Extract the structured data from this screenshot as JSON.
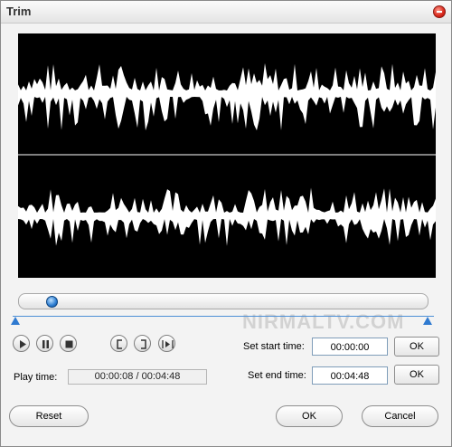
{
  "window": {
    "title": "Trim"
  },
  "waveform": {
    "background": "#000000",
    "color": "#ffffff",
    "channels": 2
  },
  "playback": {
    "play_time_label": "Play time:",
    "position": "00:00:08 / 00:04:48",
    "slider_fraction": 0.05
  },
  "controls": {
    "play": "play-icon",
    "pause": "pause-icon",
    "stop": "stop-icon",
    "set_start": "mark-start-icon",
    "set_end": "mark-end-icon",
    "play_selection": "play-selection-icon"
  },
  "trim": {
    "start_label": "Set start time:",
    "start_value": "00:00:00",
    "start_ok": "OK",
    "end_label": "Set end time:",
    "end_value": "00:04:48",
    "end_ok": "OK"
  },
  "footer": {
    "reset_label": "Reset",
    "ok_label": "OK",
    "cancel_label": "Cancel"
  },
  "watermark": "NIRMALTV.COM"
}
